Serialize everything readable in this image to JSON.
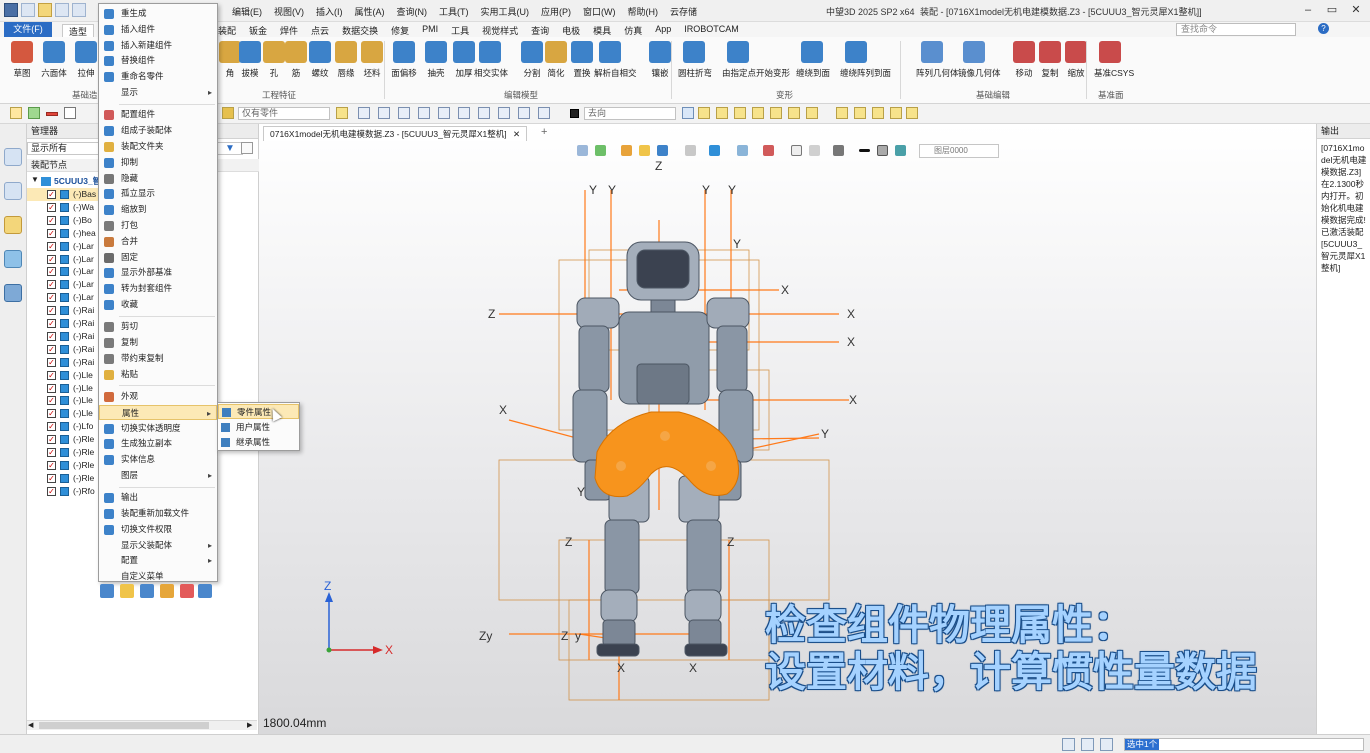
{
  "app": {
    "name": "中望3D 2025 SP2 x64",
    "doc_title": "装配 - [0716X1model无机电建模数据.Z3 - [5CUUU3_智元灵犀X1整机]]"
  },
  "menubar": {
    "items": [
      "编辑(E)",
      "视图(V)",
      "插入(I)",
      "属性(A)",
      "查询(N)",
      "工具(T)",
      "实用工具(U)",
      "应用(P)",
      "窗口(W)",
      "帮助(H)",
      "云存储"
    ]
  },
  "tabs": {
    "file": "文件(F)",
    "active": "造型",
    "items": [
      "装配",
      "钣金",
      "焊件",
      "点云",
      "数据交换",
      "修复",
      "PMI",
      "工具",
      "视觉样式",
      "查询",
      "电极",
      "模具",
      "仿真",
      "App",
      "IROBOTCAM"
    ],
    "search_placeholder": "查找命令"
  },
  "ribbon": {
    "buttons": [
      {
        "label": "草图",
        "icon": "sketch-icon"
      },
      {
        "label": "六面体",
        "icon": "block-icon"
      },
      {
        "label": "拉伸",
        "icon": "extrude-icon"
      },
      {
        "label": "角",
        "icon": "chamfer-icon"
      },
      {
        "label": "拔模",
        "icon": "draft-icon"
      },
      {
        "label": "孔",
        "icon": "hole-icon"
      },
      {
        "label": "筋",
        "icon": "rib-icon"
      },
      {
        "label": "螺纹",
        "icon": "thread-icon"
      },
      {
        "label": "唇缘",
        "icon": "lip-icon"
      },
      {
        "label": "坯料",
        "icon": "stock-icon"
      },
      {
        "label": "面偏移",
        "icon": "offset-face-icon"
      },
      {
        "label": "抽壳",
        "icon": "shell-icon"
      },
      {
        "label": "加厚",
        "icon": "thicken-icon"
      },
      {
        "label": "相交实体",
        "icon": "intersect-icon"
      },
      {
        "label": "分割",
        "icon": "split-icon"
      },
      {
        "label": "简化",
        "icon": "simplify-icon"
      },
      {
        "label": "置换",
        "icon": "replace-icon"
      },
      {
        "label": "解析自相交",
        "icon": "self-intersect-icon"
      },
      {
        "label": "镶嵌",
        "icon": "emboss-icon"
      },
      {
        "label": "圆柱折弯",
        "icon": "cylinder-bend-icon"
      },
      {
        "label": "由指定点开始变形",
        "icon": "deform-icon"
      },
      {
        "label": "缠绕到面",
        "icon": "wrap-icon"
      },
      {
        "label": "缠绕阵列到面",
        "icon": "wrap-pattern-icon"
      },
      {
        "label": "阵列几何体",
        "icon": "pattern-icon"
      },
      {
        "label": "镜像几何体",
        "icon": "mirror-icon"
      },
      {
        "label": "移动",
        "icon": "move-icon"
      },
      {
        "label": "复制",
        "icon": "copy-icon"
      },
      {
        "label": "缩放",
        "icon": "scale-icon"
      },
      {
        "label": "基准CSYS",
        "icon": "csys-icon"
      }
    ],
    "groups": [
      "基础造",
      "工程特征",
      "编辑模型",
      "变形",
      "基础编辑",
      "基准面"
    ]
  },
  "toolbar2": {
    "filter_value": "仅有零件",
    "direction_value": "去向"
  },
  "manager": {
    "title": "管理器",
    "filter_value": "显示所有",
    "column_header": "装配节点",
    "root": "5CUUU3_智",
    "rows": [
      "(-)Bas",
      "(-)Wa",
      "(-)Bo",
      "(-)hea",
      "(-)Lar",
      "(-)Lar",
      "(-)Lar",
      "(-)Lar",
      "(-)Lar",
      "(-)Rai",
      "(-)Rai",
      "(-)Rai",
      "(-)Rai",
      "(-)Rai",
      "(-)Lle",
      "(-)Lle",
      "(-)Lle",
      "(-)Lle",
      "(-)Lfo",
      "(-)Rle",
      "(-)Rle",
      "(-)Rle",
      "(-)Rle",
      "(-)Rfo"
    ]
  },
  "context_menu": {
    "items": [
      {
        "label": "重生成",
        "arrow": false
      },
      {
        "label": "插入组件",
        "arrow": false
      },
      {
        "label": "插入新建组件",
        "arrow": false
      },
      {
        "label": "替换组件",
        "arrow": false
      },
      {
        "label": "重命名零件",
        "arrow": false
      },
      {
        "label": "显示",
        "arrow": true
      },
      {
        "label": "配置组件",
        "arrow": false
      },
      {
        "label": "组成子装配体",
        "arrow": false
      },
      {
        "label": "装配文件夹",
        "arrow": false
      },
      {
        "label": "抑制",
        "arrow": false
      },
      {
        "label": "隐藏",
        "arrow": false
      },
      {
        "label": "孤立显示",
        "arrow": false
      },
      {
        "label": "缩放到",
        "arrow": false
      },
      {
        "label": "打包",
        "arrow": false
      },
      {
        "label": "合并",
        "arrow": false
      },
      {
        "label": "固定",
        "arrow": false
      },
      {
        "label": "显示外部基准",
        "arrow": false
      },
      {
        "label": "转为封套组件",
        "arrow": false
      },
      {
        "label": "收藏",
        "arrow": false
      },
      {
        "label": "剪切",
        "arrow": false
      },
      {
        "label": "复制",
        "arrow": false
      },
      {
        "label": "带约束复制",
        "arrow": false
      },
      {
        "label": "粘贴",
        "arrow": false
      },
      {
        "label": "外观",
        "arrow": false
      },
      {
        "label": "属性",
        "arrow": true
      },
      {
        "label": "切换实体透明度",
        "arrow": false
      },
      {
        "label": "生成独立副本",
        "arrow": false
      },
      {
        "label": "实体信息",
        "arrow": false
      },
      {
        "label": "图层",
        "arrow": true
      },
      {
        "label": "输出",
        "arrow": false
      },
      {
        "label": "装配重新加载文件",
        "arrow": false
      },
      {
        "label": "切换文件权限",
        "arrow": false
      },
      {
        "label": "显示父装配体",
        "arrow": true
      },
      {
        "label": "配置",
        "arrow": true
      },
      {
        "label": "自定义菜单",
        "arrow": false
      }
    ]
  },
  "submenu": {
    "items": [
      "零件属性",
      "用户属性",
      "继承属性"
    ]
  },
  "viewport": {
    "doc_tab": "0716X1model无机电建模数据.Z3 - [5CUUU3_智元灵犀X1整机]",
    "layer_value": "图层0000",
    "distance": "1800.04mm",
    "caption_line1": "检查组件物理属性：",
    "caption_line2": "设置材料，计算惯性量数据",
    "axis_labels": [
      "Z",
      "X",
      "Y"
    ]
  },
  "output": {
    "title": "输出",
    "text": "[0716X1model无机电建模数据.Z3]在2.1300秒内打开。初始化机电建模数据完成!已激活装配[5CUUU3_智元灵犀X1整机]"
  },
  "status": {
    "selection": "选中1个"
  },
  "colors": {
    "accent": "#2b6cc4",
    "highlight": "#fce9b6",
    "selected_part": "#f7941d",
    "caption": "#a5d2ff",
    "axis": "#ff7a1a"
  }
}
